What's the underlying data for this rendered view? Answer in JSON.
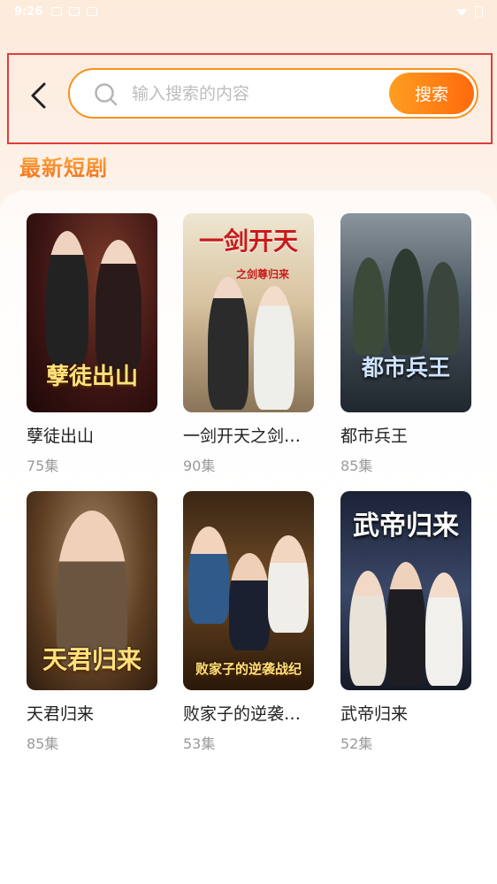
{
  "status_bar": {
    "time": "9:26"
  },
  "search": {
    "placeholder": "输入搜索的内容",
    "button_label": "搜索"
  },
  "section": {
    "title": "最新短剧"
  },
  "dramas": [
    {
      "title": "孽徒出山",
      "episodes": "75集",
      "poster_text": "孽徒出山",
      "bg": "#3a1412"
    },
    {
      "title": "一剑开天之剑…",
      "episodes": "90集",
      "poster_text": "一剑开天",
      "poster_sub": "之剑尊归来",
      "bg": "#d7c6a3"
    },
    {
      "title": "都市兵王",
      "episodes": "85集",
      "poster_text": "都市兵王",
      "bg": "#3b4650"
    },
    {
      "title": "天君归来",
      "episodes": "85集",
      "poster_text": "天君归来",
      "bg": "#6b4a2e"
    },
    {
      "title": "败家子的逆袭…",
      "episodes": "53集",
      "poster_text": "败家子的逆袭战纪",
      "bg": "#5b3a1e"
    },
    {
      "title": "武帝归来",
      "episodes": "52集",
      "poster_text": "武帝归来",
      "bg": "#2b3550"
    }
  ]
}
